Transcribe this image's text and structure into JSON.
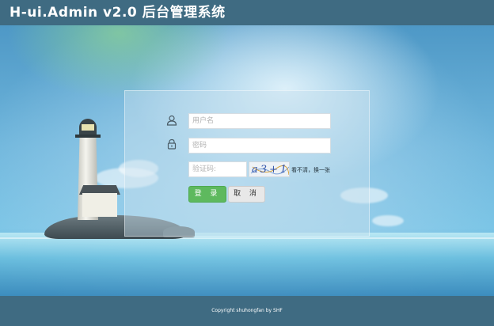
{
  "header": {
    "title": "H-ui.Admin v2.0 后台管理系统"
  },
  "login": {
    "username_placeholder": "用户名",
    "password_placeholder": "密码",
    "captcha_placeholder": "验证码:",
    "captcha_text": "a3+15",
    "refresh_text": "看不清，换一张",
    "login_button": "登 录",
    "cancel_button": "取 消"
  },
  "footer": {
    "copyright": "Copyright shuhongfan by SHF"
  },
  "icons": {
    "username": "user-icon",
    "password": "lock-icon"
  },
  "colors": {
    "header_bg": "#3f6b82",
    "login_button": "#5eb95e",
    "cancel_button": "#e8e8e8"
  }
}
